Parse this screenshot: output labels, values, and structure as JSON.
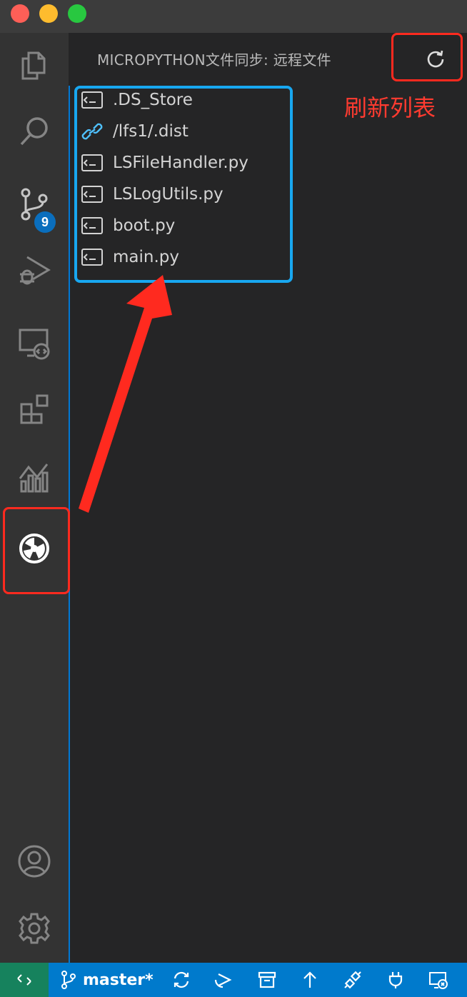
{
  "window": {
    "traffic_lights": {
      "close": "#fe5f57",
      "minimize": "#febc2e",
      "maximize": "#28c840"
    }
  },
  "activity_bar": {
    "items": [
      {
        "icon": "explorer-files-icon"
      },
      {
        "icon": "search-icon"
      },
      {
        "icon": "source-control-icon",
        "badge": "9"
      },
      {
        "icon": "run-debug-icon"
      },
      {
        "icon": "remote-explorer-icon"
      },
      {
        "icon": "extensions-icon"
      },
      {
        "icon": "chart-icon"
      },
      {
        "icon": "micropython-sync-icon",
        "active": true
      }
    ],
    "bottom": [
      {
        "icon": "account-icon"
      },
      {
        "icon": "gear-icon"
      }
    ]
  },
  "sidebar": {
    "title": "MICROPYTHON文件同步: 远程文件",
    "refresh_icon": "refresh-icon",
    "files": [
      {
        "name": ".DS_Store",
        "icon": "terminal-file-icon"
      },
      {
        "name": "/lfs1/.dist",
        "icon": "link-icon"
      },
      {
        "name": "LSFileHandler.py",
        "icon": "terminal-file-icon"
      },
      {
        "name": "LSLogUtils.py",
        "icon": "terminal-file-icon"
      },
      {
        "name": "boot.py",
        "icon": "terminal-file-icon"
      },
      {
        "name": "main.py",
        "icon": "terminal-file-icon"
      }
    ]
  },
  "annotation": {
    "refresh_label": "刷新列表",
    "colors": {
      "red": "#ff2a1f",
      "blue": "#18a7f0"
    }
  },
  "status_bar": {
    "branch": "master*",
    "colors": {
      "background": "#007acc",
      "remote": "#16825d"
    }
  }
}
